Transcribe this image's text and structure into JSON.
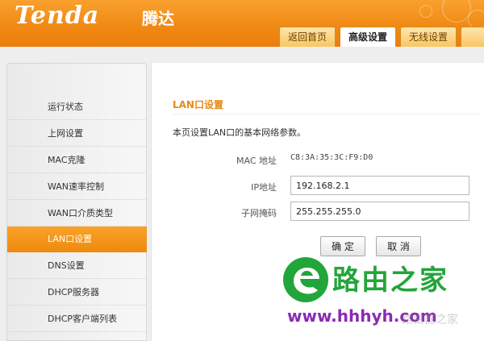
{
  "header": {
    "logo_text": "Tenda",
    "logo_cn": "腾达",
    "tabs": [
      {
        "label": "返回首页",
        "active": false
      },
      {
        "label": "高级设置",
        "active": true
      },
      {
        "label": "无线设置",
        "active": false
      },
      {
        "label": "",
        "active": false
      }
    ]
  },
  "sidebar": {
    "items": [
      {
        "label": "运行状态",
        "active": false
      },
      {
        "label": "上网设置",
        "active": false
      },
      {
        "label": "MAC克隆",
        "active": false
      },
      {
        "label": "WAN速率控制",
        "active": false
      },
      {
        "label": "WAN口介质类型",
        "active": false
      },
      {
        "label": "LAN口设置",
        "active": true
      },
      {
        "label": "DNS设置",
        "active": false
      },
      {
        "label": "DHCP服务器",
        "active": false
      },
      {
        "label": "DHCP客户端列表",
        "active": false
      }
    ]
  },
  "main": {
    "title": "LAN口设置",
    "description": "本页设置LAN口的基本网络参数。",
    "mac_label": "MAC 地址",
    "mac_value": "C8:3A:35:3C:F9:D0",
    "ip_label": "IP地址",
    "ip_value": "192.168.2.1",
    "mask_label": "子网掩码",
    "mask_value": "255.255.255.0",
    "confirm_label": "确 定",
    "cancel_label": "取 消"
  },
  "watermark": {
    "brand": "路由之家",
    "url": "www.hhhyh.com",
    "faint_text": "路由器之家"
  },
  "colors": {
    "brand_orange": "#f08a14",
    "watermark_green": "#22a53a",
    "watermark_purple": "#8a2ab3"
  }
}
